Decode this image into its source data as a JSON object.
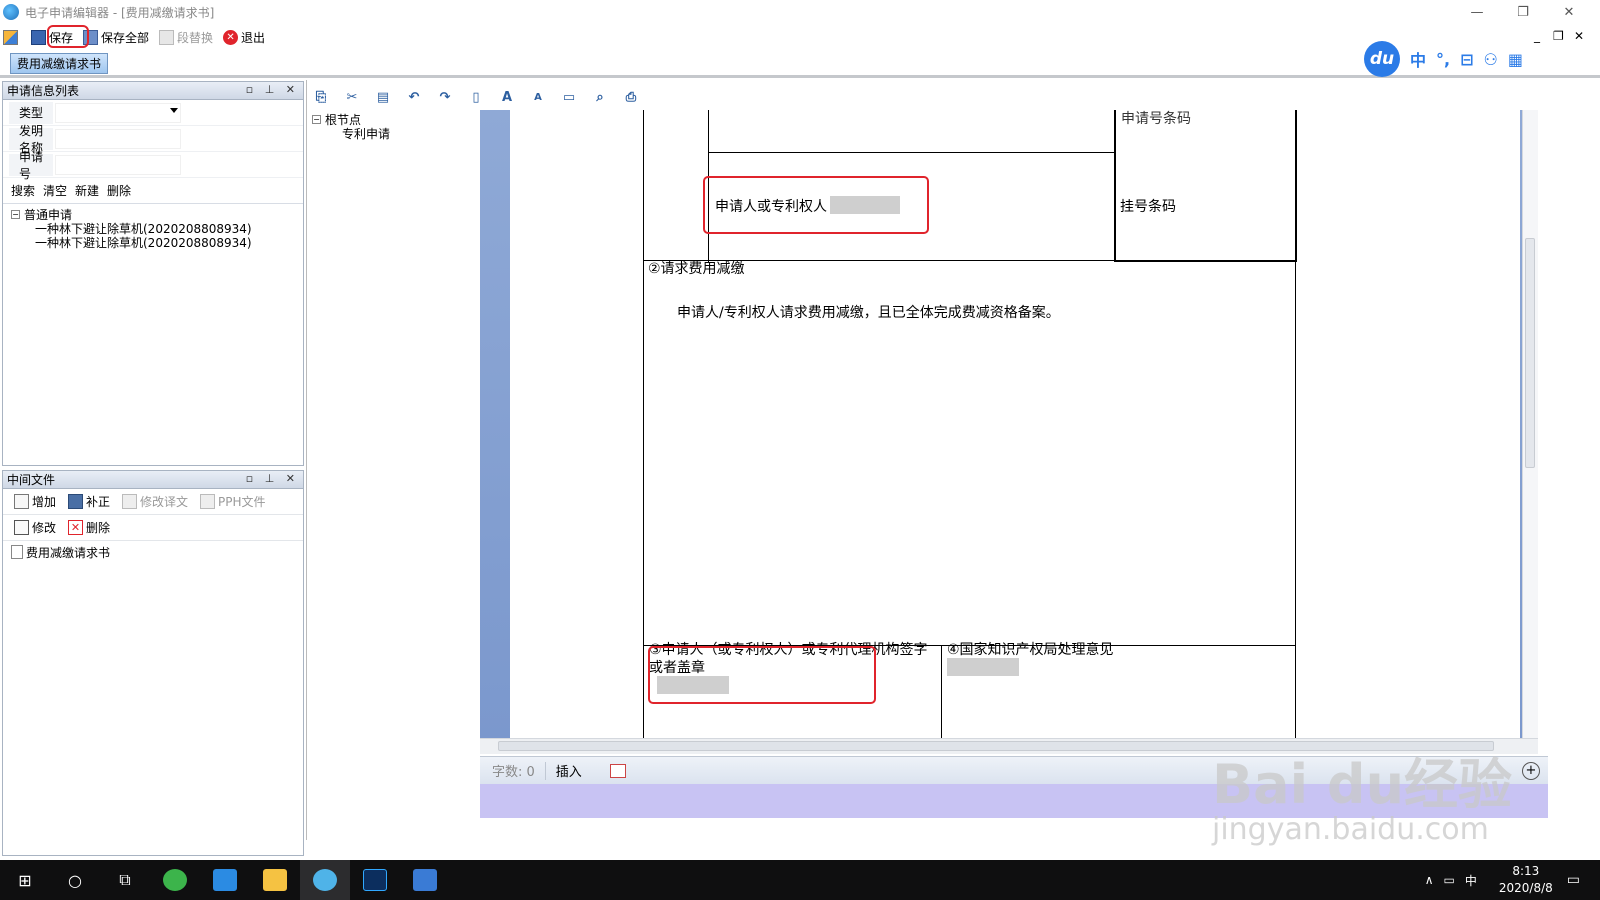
{
  "window": {
    "title": "电子申请编辑器 - [费用减缴请求书]"
  },
  "toolbar": {
    "save": "保存",
    "save_all": "保存全部",
    "replace": "段替换",
    "exit": "退出"
  },
  "doc_tab": "费用减缴请求书",
  "ime": {
    "logo": "du",
    "items": [
      "中",
      "°,",
      "⊟",
      "⚇",
      "▦"
    ]
  },
  "left_top_panel": {
    "title": "申请信息列表",
    "fields": [
      {
        "label": "类型",
        "value": ""
      },
      {
        "label": "发明名称",
        "value": ""
      },
      {
        "label": "申请号",
        "value": ""
      }
    ],
    "actions": [
      "搜索",
      "清空",
      "新建",
      "删除"
    ],
    "tree": {
      "root": "普通申请",
      "children": [
        "一种林下避让除草机(2020208808934)",
        "一种林下避让除草机(2020208808934)"
      ]
    }
  },
  "left_bottom_panel": {
    "title": "中间文件",
    "row1": [
      "增加",
      "补正",
      "修改译文",
      "PPH文件"
    ],
    "row2": [
      "修改",
      "删除"
    ],
    "files": [
      "费用减缴请求书"
    ]
  },
  "outline": {
    "root": "根节点",
    "child": "专利申请"
  },
  "document": {
    "applicant_label": "申请人或专利权人",
    "barcode_label": "挂号条码",
    "app_number_label": "申请号条码",
    "section2_title": "②请求费用减缴",
    "section2_text": "申请人/专利权人请求费用减缴，且已全体完成费减资格备案。",
    "section3_title_line1": "③申请人（或专利权人）或专利代理机构签字",
    "section3_title_line2": "或者盖章",
    "section4_title": "④国家知识产权局处理意见"
  },
  "statusbar": {
    "word_count": "字数: 0",
    "mode": "插入"
  },
  "watermark": {
    "main": "Bai du经验",
    "sub": "jingyan.baidu.com"
  },
  "taskbar": {
    "time": "8:13",
    "date": "2020/8/8",
    "ime": "中"
  }
}
